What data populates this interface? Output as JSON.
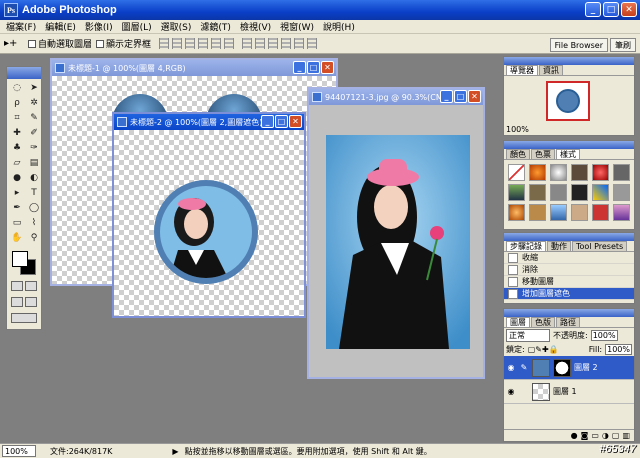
{
  "app": {
    "title": "Adobe Photoshop",
    "logo_text": "Ps"
  },
  "window_buttons": {
    "minimize": "_",
    "maximize": "□",
    "close": "✕"
  },
  "menu": [
    "檔案(F)",
    "編輯(E)",
    "影像(I)",
    "圖層(L)",
    "選取(S)",
    "濾鏡(T)",
    "檢視(V)",
    "視窗(W)",
    "說明(H)"
  ],
  "options": {
    "tool_glyph": "▸+",
    "auto_select": "自動選取圖層",
    "show_bounds": "顯示定界框"
  },
  "well_tabs": [
    "File Browser",
    "筆刷"
  ],
  "documents": [
    {
      "title": "未標題-1 @ 100%(圖層 4,RGB)"
    },
    {
      "title": "未標題-2 @ 100%(圖層 2,圖層遮色)"
    },
    {
      "title": "94407121-3.jpg @ 90.3%(CM..."
    }
  ],
  "navigator": {
    "tabs": [
      "導覽器",
      "資訊"
    ],
    "zoom": "100%"
  },
  "swatches": {
    "tabs": [
      "顏色",
      "色票",
      "樣式"
    ]
  },
  "history": {
    "tabs": [
      "步驟記錄",
      "動作",
      "Tool Presets"
    ],
    "items": [
      "收縮",
      "消除",
      "移動圖層",
      "增加圖層遮色"
    ]
  },
  "layers": {
    "tabs": [
      "圖層",
      "色版",
      "路徑"
    ],
    "blend_mode": "正常",
    "opacity_label": "不透明度:",
    "opacity": "100%",
    "lock_label": "鎖定:",
    "fill_label": "Fill:",
    "fill": "100%",
    "items": [
      {
        "name": "圖層 2",
        "selected": true
      },
      {
        "name": "圖層 1",
        "selected": false
      }
    ]
  },
  "status": {
    "zoom": "100%",
    "doc_info": "文件:264K/817K",
    "hint": "點按並拖移以移動圖層或選區。要用附加選項，使用 Shift 和 Alt 鍵。"
  },
  "watermark": "#65347",
  "colors": {
    "title_blue": "#0a3fc8",
    "sky_blue": "#6fb4e0",
    "gown_black": "#111111",
    "hat_pink": "#f07aa6",
    "selection_blue": "#2f5bc8"
  }
}
